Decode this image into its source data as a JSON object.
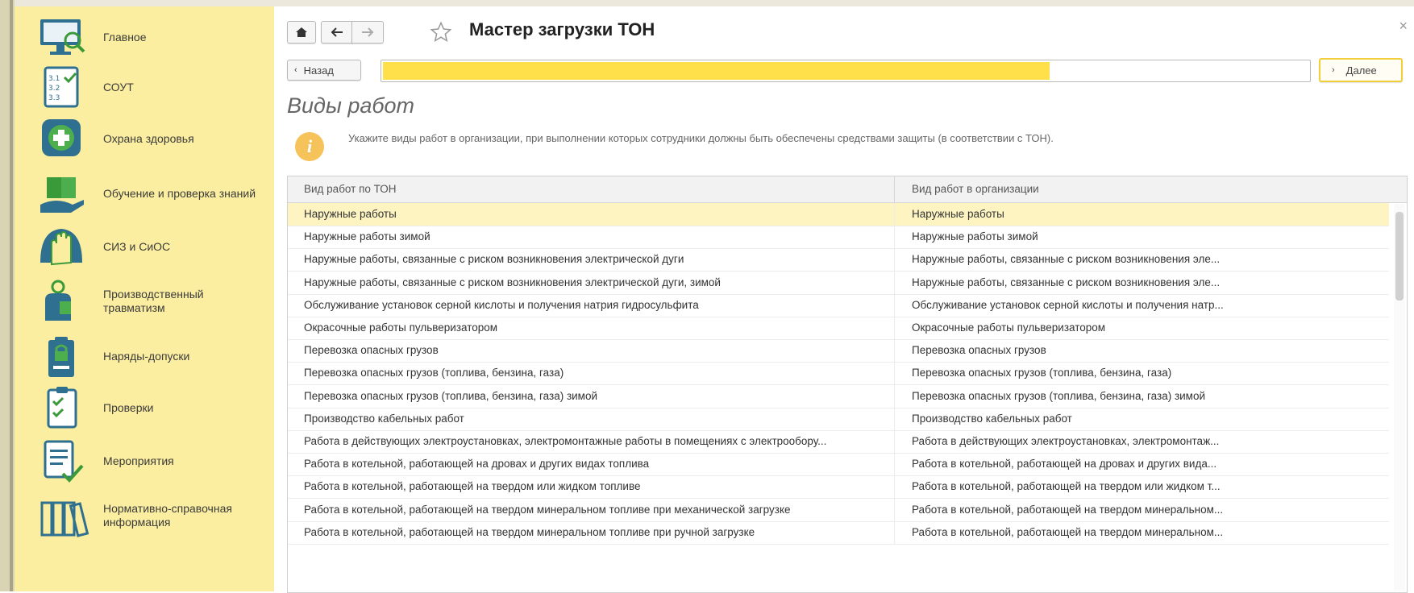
{
  "sidebar": {
    "items": [
      {
        "label": "Главное",
        "icon": "monitor-search-icon"
      },
      {
        "label": "СОУТ",
        "icon": "checklist-numbers-icon"
      },
      {
        "label": "Охрана здоровья",
        "icon": "medical-cross-icon"
      },
      {
        "label": "Обучение и проверка знаний",
        "icon": "book-hand-icon"
      },
      {
        "label": "СИЗ и СиОС",
        "icon": "glove-hand-icon"
      },
      {
        "label": "Производственный травматизм",
        "icon": "injured-worker-icon"
      },
      {
        "label": "Наряды-допуски",
        "icon": "permit-lock-icon"
      },
      {
        "label": "Проверки",
        "icon": "clipboard-check-icon"
      },
      {
        "label": "Мероприятия",
        "icon": "document-check-icon"
      },
      {
        "label": "Нормативно-справочная информация",
        "icon": "binders-icon"
      }
    ]
  },
  "header": {
    "title": "Мастер загрузки ТОН",
    "home_icon": "home-icon",
    "back_icon": "arrow-left-icon",
    "forward_icon": "arrow-right-icon",
    "favorite_icon": "star-outline-icon",
    "close_glyph": "×"
  },
  "wizard": {
    "back_label": "Назад",
    "next_label": "Далее",
    "progress_fraction": 0.72
  },
  "section": {
    "title": "Виды работ",
    "info_glyph": "i",
    "info_text": "Укажите виды работ в организации, при выполнении которых сотрудники должны быть обеспечены средствами защиты (в соответствии с ТОН)."
  },
  "grid": {
    "columns": [
      "Вид работ по ТОН",
      "Вид работ в организации"
    ],
    "rows": [
      [
        "Наружные работы",
        "Наружные работы"
      ],
      [
        "Наружные работы зимой",
        "Наружные работы зимой"
      ],
      [
        "Наружные работы, связанные с риском возникновения электрической дуги",
        "Наружные работы, связанные с риском возникновения эле..."
      ],
      [
        "Наружные работы, связанные с риском возникновения электрической дуги, зимой",
        "Наружные работы, связанные с риском возникновения эле..."
      ],
      [
        "Обслуживание установок серной кислоты и получения натрия гидросульфита",
        "Обслуживание установок серной кислоты и получения натр..."
      ],
      [
        "Окрасочные работы пульверизатором",
        "Окрасочные работы пульверизатором"
      ],
      [
        "Перевозка опасных грузов",
        "Перевозка опасных грузов"
      ],
      [
        "Перевозка опасных грузов (топлива, бензина, газа)",
        "Перевозка опасных грузов (топлива, бензина, газа)"
      ],
      [
        "Перевозка опасных грузов (топлива, бензина, газа) зимой",
        "Перевозка опасных грузов (топлива, бензина, газа) зимой"
      ],
      [
        "Производство кабельных работ",
        "Производство кабельных работ"
      ],
      [
        "Работа в действующих электроустановках, электромонтажные работы в помещениях с электрообору...",
        "Работа в действующих электроустановках, электромонтаж..."
      ],
      [
        "Работа в котельной, работающей на дровах и других видах топлива",
        "Работа в котельной, работающей на дровах и других вида..."
      ],
      [
        "Работа в котельной, работающей на твердом или жидком топливе",
        "Работа в котельной, работающей на твердом или жидком т..."
      ],
      [
        "Работа в котельной, работающей на твердом минеральном топливе при механической загрузке",
        "Работа в котельной, работающей на твердом минеральном..."
      ],
      [
        "Работа в котельной, работающей на твердом минеральном топливе при ручной загрузке",
        "Работа в котельной, работающей на твердом минеральном..."
      ]
    ],
    "selected_row": 0
  },
  "colors": {
    "sidebar_bg": "#fbeea0",
    "accent_yellow": "#ffe04a",
    "icon_teal": "#2f6f8f",
    "selected_row": "#fdf4c2"
  }
}
